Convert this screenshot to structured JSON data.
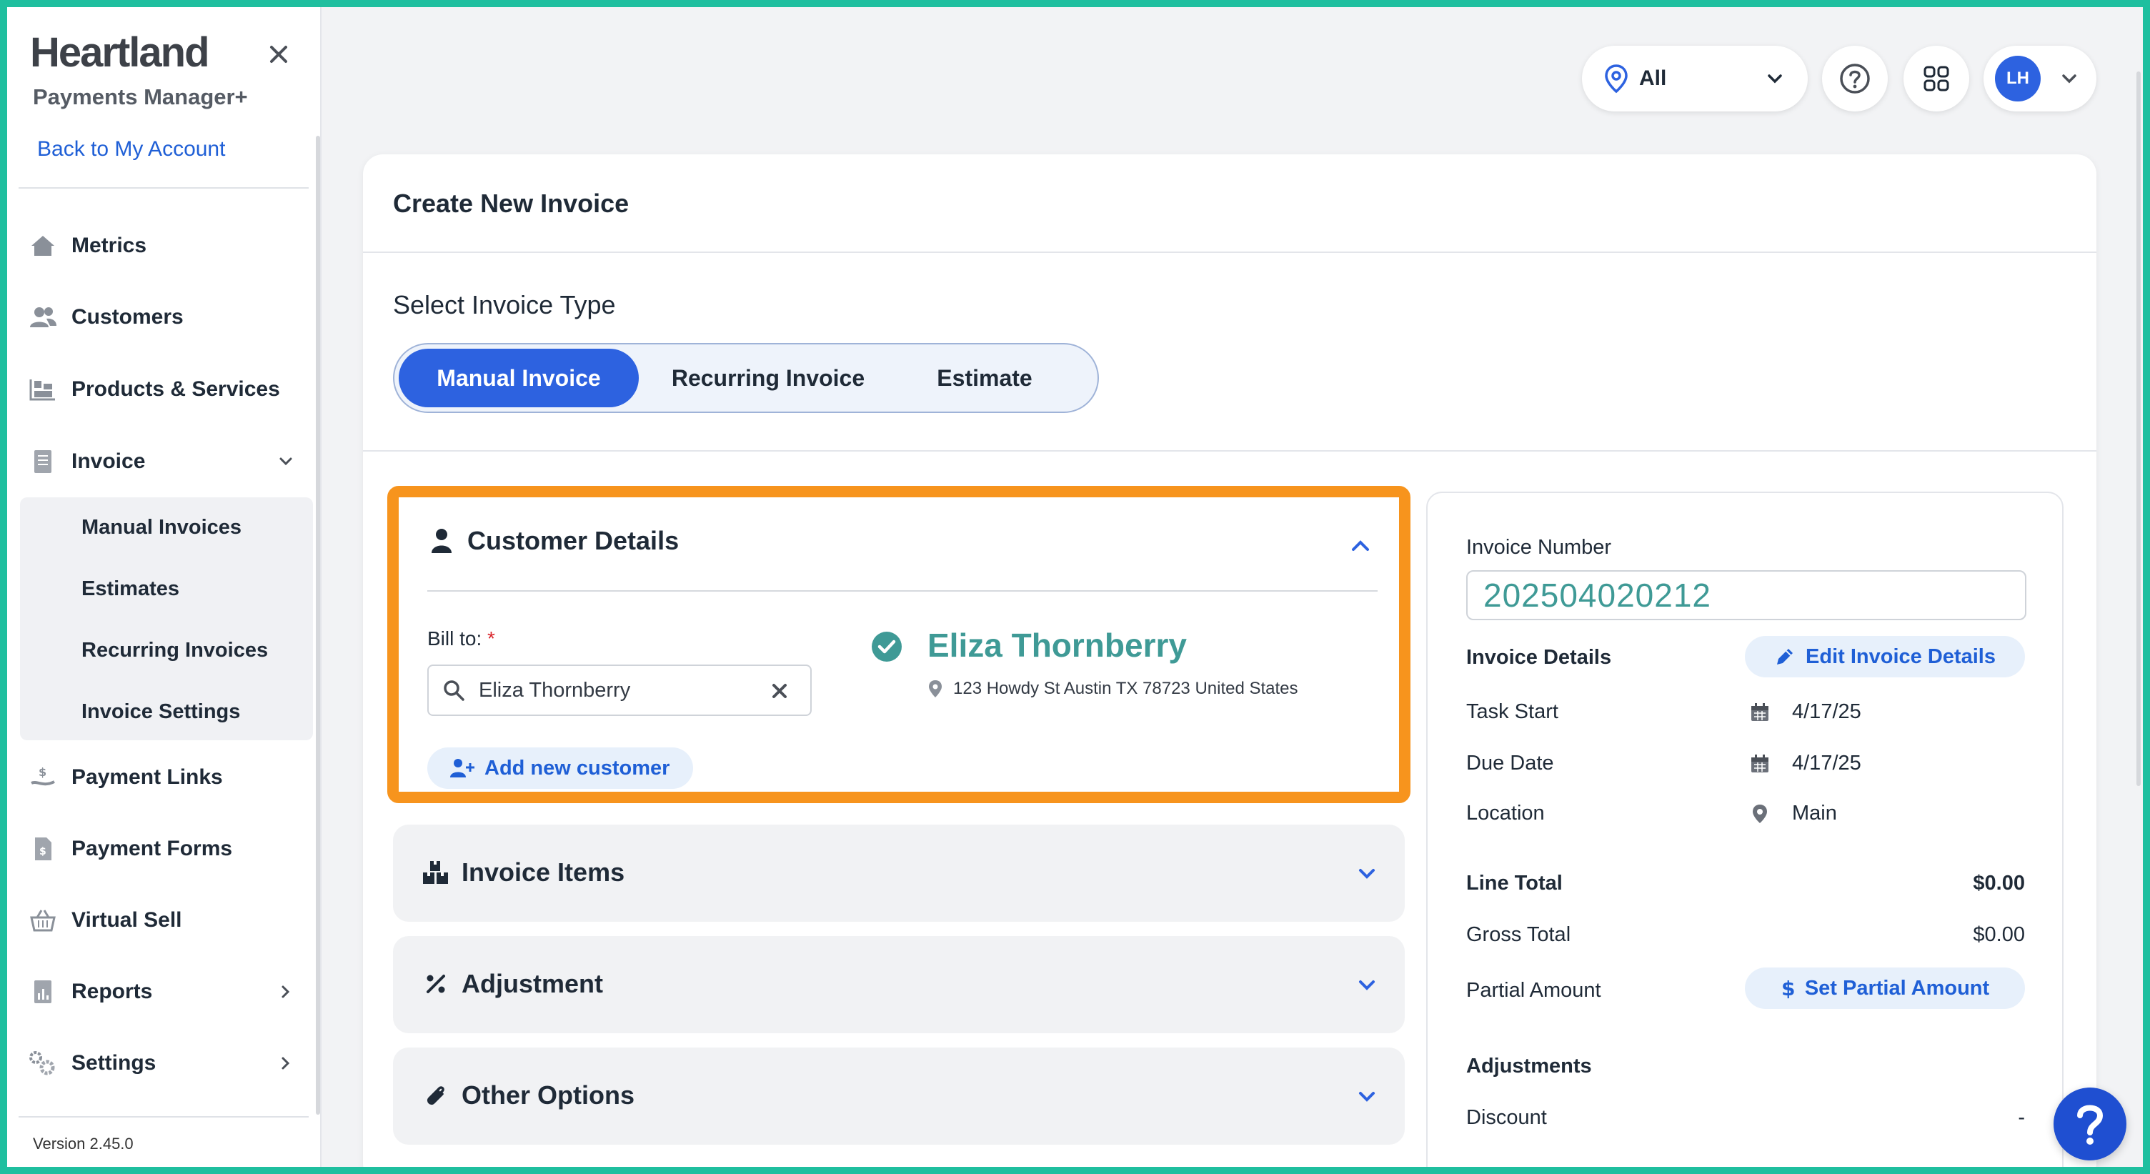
{
  "sidebar": {
    "brand_title": "Heartland",
    "brand_subtitle": "Payments Manager+",
    "back_link": "Back to My Account",
    "items": [
      {
        "label": "Metrics",
        "icon": "home-icon"
      },
      {
        "label": "Customers",
        "icon": "users-icon"
      },
      {
        "label": "Products & Services",
        "icon": "products-icon"
      },
      {
        "label": "Invoice",
        "icon": "invoice-icon"
      },
      {
        "label": "Payment Links",
        "icon": "payment-link-icon"
      },
      {
        "label": "Payment Forms",
        "icon": "payment-form-icon"
      },
      {
        "label": "Virtual Sell",
        "icon": "basket-icon"
      },
      {
        "label": "Reports",
        "icon": "reports-icon"
      },
      {
        "label": "Settings",
        "icon": "gear-icon"
      }
    ],
    "invoice_submenu": [
      "Manual Invoices",
      "Estimates",
      "Recurring Invoices",
      "Invoice Settings"
    ],
    "version": "Version 2.45.0"
  },
  "topbar": {
    "location_value": "All",
    "avatar_initials": "LH"
  },
  "main": {
    "title": "Create New Invoice",
    "type_label": "Select Invoice Type",
    "invoice_types": [
      "Manual Invoice",
      "Recurring Invoice",
      "Estimate"
    ],
    "active_type": "Manual Invoice",
    "customer_details": {
      "title": "Customer Details",
      "bill_to_label": "Bill to:",
      "required_mark": "*",
      "search_value": "Eliza Thornberry",
      "add_customer_label": "Add new customer",
      "customer_name": "Eliza Thornberry",
      "customer_address": "123 Howdy St Austin TX 78723 United States"
    },
    "sections": [
      "Invoice Items",
      "Adjustment",
      "Other Options"
    ]
  },
  "panel": {
    "invoice_number_label": "Invoice Number",
    "invoice_number": "202504020212",
    "invoice_details_label": "Invoice Details",
    "edit_details_label": "Edit Invoice Details",
    "task_start_label": "Task Start",
    "task_start": "4/17/25",
    "due_date_label": "Due Date",
    "due_date": "4/17/25",
    "location_label": "Location",
    "location": "Main",
    "line_total_label": "Line Total",
    "line_total": "$0.00",
    "gross_total_label": "Gross Total",
    "gross_total": "$0.00",
    "partial_amount_label": "Partial Amount",
    "set_partial_label": "Set Partial Amount",
    "adjustments_label": "Adjustments",
    "discount_label": "Discount",
    "discount_value": "-"
  },
  "colors": {
    "accent": "#2d62e0",
    "highlight_border": "#f7941d",
    "frame": "#1fbf9f",
    "customer_name": "#3f9a96"
  }
}
